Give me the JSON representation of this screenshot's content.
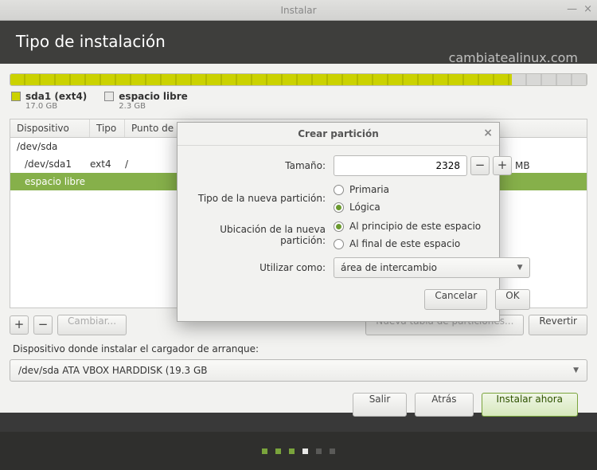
{
  "window": {
    "title": "Instalar"
  },
  "header": {
    "title": "Tipo de instalación",
    "watermark": "cambiatealinux.com"
  },
  "legend": {
    "a": {
      "name": "sda1 (ext4)",
      "size": "17.0 GB"
    },
    "b": {
      "name": "espacio libre",
      "size": "2.3 GB"
    }
  },
  "columns": {
    "device": "Dispositivo",
    "type": "Tipo",
    "mount": "Punto de"
  },
  "rows": [
    {
      "device": "/dev/sda",
      "type": "",
      "mount": "",
      "indent": false,
      "selected": false
    },
    {
      "device": "/dev/sda1",
      "type": "ext4",
      "mount": "/",
      "indent": true,
      "selected": false
    },
    {
      "device": "espacio libre",
      "type": "",
      "mount": "",
      "indent": true,
      "selected": true
    }
  ],
  "toolbar": {
    "add": "+",
    "remove": "−",
    "change": "Cambiar...",
    "newtable": "Nueva tabla de particiones...",
    "revert": "Revertir"
  },
  "bootloader": {
    "label": "Dispositivo donde instalar el cargador de arranque:",
    "value": "/dev/sda   ATA VBOX HARDDISK (19.3 GB"
  },
  "footer": {
    "quit": "Salir",
    "back": "Atrás",
    "install": "Instalar ahora"
  },
  "dialog": {
    "title": "Crear partición",
    "size_label": "Tamaño:",
    "size_value": "2328",
    "size_unit": "MB",
    "type_label": "Tipo de la nueva partición:",
    "type_primary": "Primaria",
    "type_logical": "Lógica",
    "loc_label": "Ubicación de la nueva partición:",
    "loc_begin": "Al principio de este espacio",
    "loc_end": "Al final de este espacio",
    "useas_label": "Utilizar como:",
    "useas_value": "área de intercambio",
    "cancel": "Cancelar",
    "ok": "OK"
  }
}
